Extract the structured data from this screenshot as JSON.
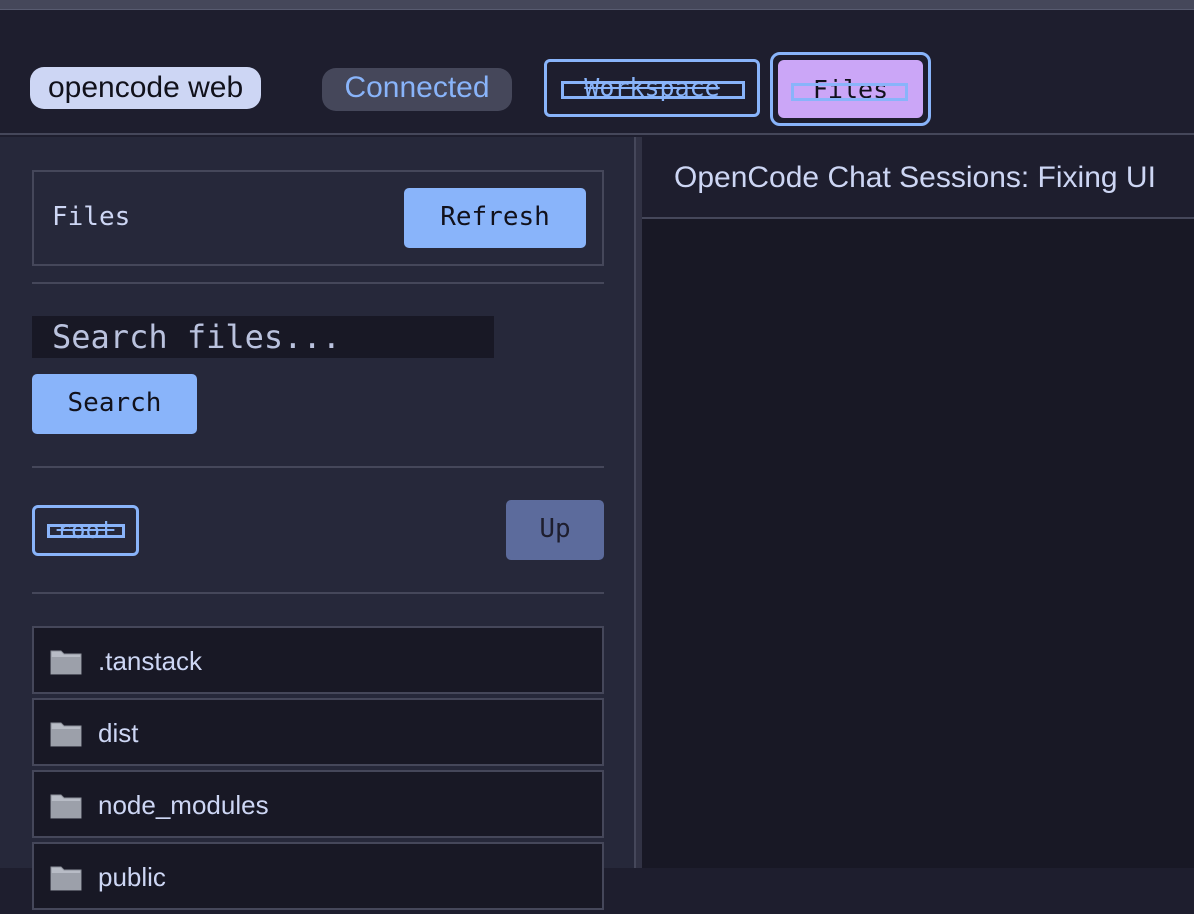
{
  "header": {
    "brand": "opencode web",
    "status": "Connected",
    "tabs": [
      {
        "label": "Workspace"
      },
      {
        "label": "Files"
      }
    ]
  },
  "sidebar": {
    "title": "Files",
    "refresh_label": "Refresh",
    "search": {
      "placeholder": "Search files...",
      "button_label": "Search"
    },
    "nav": {
      "root_label": "root",
      "up_label": "Up"
    },
    "files": [
      {
        "name": ".tanstack",
        "icon": "folder-icon"
      },
      {
        "name": "dist",
        "icon": "folder-icon"
      },
      {
        "name": "node_modules",
        "icon": "folder-icon"
      },
      {
        "name": "public",
        "icon": "folder-icon"
      }
    ]
  },
  "main": {
    "session_title": "OpenCode Chat Sessions: Fixing UI"
  },
  "colors": {
    "background": "#1e1e2e",
    "accent": "#89b4fa",
    "active_tab": "#cba6f7"
  }
}
